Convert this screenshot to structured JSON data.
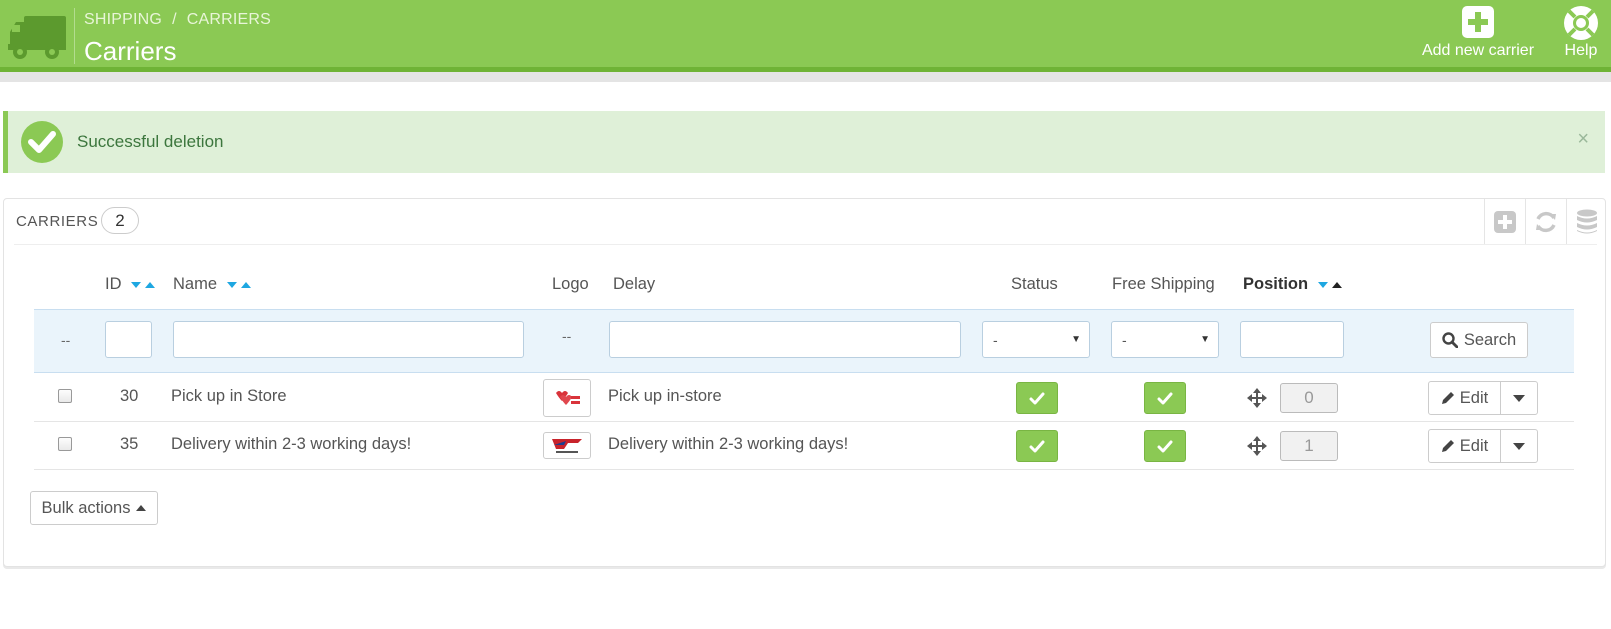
{
  "header": {
    "breadcrumb": [
      "SHIPPING",
      "CARRIERS"
    ],
    "breadcrumb_sep": "/",
    "title": "Carriers",
    "truck_icon": "truck-icon",
    "toolbar": [
      {
        "label": "Add new carrier",
        "icon": "plus-square-icon"
      },
      {
        "label": "Help",
        "icon": "lifebuoy-icon"
      }
    ]
  },
  "alert": {
    "message": "Successful deletion",
    "close": "×",
    "icon": "check-circle-icon"
  },
  "panel": {
    "title": "CARRIERS",
    "count": "2",
    "tools": [
      "add-icon",
      "refresh-icon",
      "database-icon"
    ]
  },
  "table": {
    "columns": [
      "ID",
      "Name",
      "Logo",
      "Delay",
      "Status",
      "Free Shipping",
      "Position"
    ],
    "filters": {
      "empty_marker": "--",
      "status_value": "-",
      "free_shipping_value": "-",
      "search_label": "Search"
    },
    "rows": [
      {
        "id": "30",
        "name": "Pick up in Store",
        "delay": "Pick up in-store",
        "status": true,
        "free_shipping": true,
        "position": "0",
        "edit_label": "Edit"
      },
      {
        "id": "35",
        "name": "Delivery within 2-3 working days!",
        "delay": "Delivery within 2-3 working days!",
        "status": true,
        "free_shipping": true,
        "position": "1",
        "edit_label": "Edit"
      }
    ],
    "bulk_label": "Bulk actions"
  },
  "colors": {
    "header_green": "#8bc954",
    "alert_bg": "#dff0d8",
    "sort_blue": "#1ea7e1"
  }
}
